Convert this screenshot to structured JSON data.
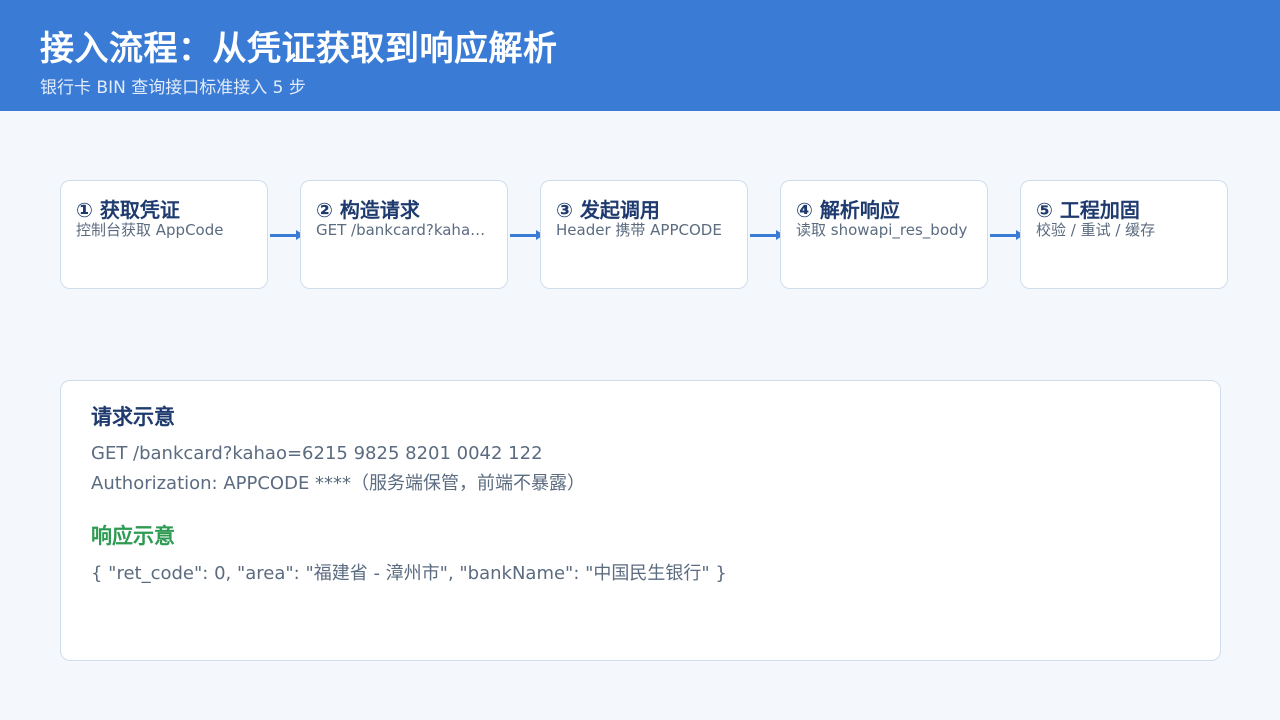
{
  "header": {
    "title": "接入流程：从凭证获取到响应解析",
    "subtitle": "银行卡 BIN 查询接口标准接入 5 步"
  },
  "steps": [
    {
      "title": "① 获取凭证",
      "desc": "控制台获取 AppCode"
    },
    {
      "title": "② 构造请求",
      "desc": "GET /bankcard?kahao=…"
    },
    {
      "title": "③ 发起调用",
      "desc": "Header 携带 APPCODE"
    },
    {
      "title": "④ 解析响应",
      "desc": "读取 showapi_res_body"
    },
    {
      "title": "⑤ 工程加固",
      "desc": "校验 / 重试 / 缓存"
    }
  ],
  "request": {
    "title": "请求示意",
    "line1": "GET /bankcard?kahao=6215 9825 8201 0042 122",
    "line2": "Authorization: APPCODE ****（服务端保管，前端不暴露）"
  },
  "response": {
    "title": "响应示意",
    "line1": "{ \"ret_code\": 0, \"area\": \"福建省 - 漳州市\", \"bankName\": \"中国民生银行\" }"
  },
  "colors": {
    "accent": "#3a7bd5",
    "heading": "#1e3a6e",
    "response_heading": "#2e9a52"
  }
}
